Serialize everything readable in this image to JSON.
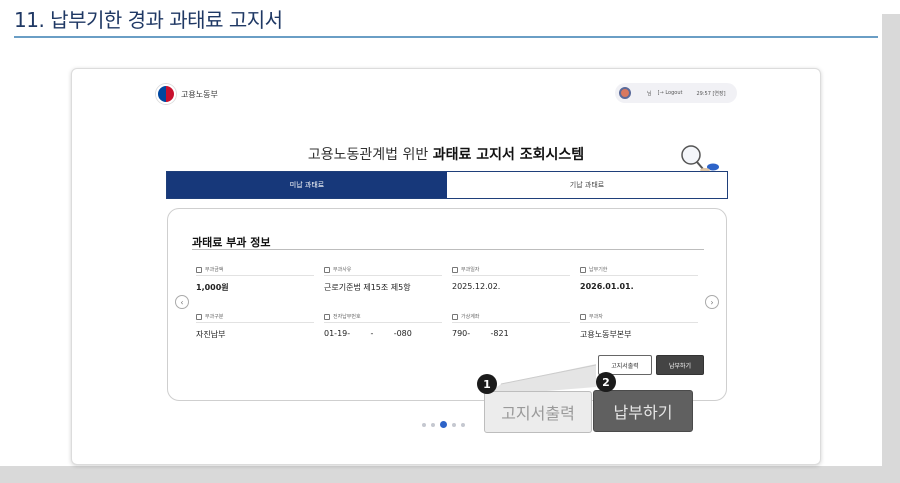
{
  "slide": {
    "title": "11. 납부기한 경과 과태료 고지서"
  },
  "header": {
    "logo_text": "고용노동부",
    "user_name": "님",
    "logout_label": "[→ Logout",
    "session_time": "29:57 [연장]"
  },
  "headline": {
    "prefix": "고용노동관계법 위반",
    "emphasis": "과태료 고지서 조회시스템"
  },
  "tabs": [
    {
      "label": "미납 과태료",
      "active": true
    },
    {
      "label": "기납 과태료",
      "active": false
    }
  ],
  "card": {
    "title": "과태료 부과 정보",
    "fields": [
      {
        "label": "부과금액",
        "value": "1,000원",
        "icon": "wallet-icon",
        "bold": true
      },
      {
        "label": "부과사유",
        "value": "근로기준법 제15조 제5항",
        "icon": "document-icon",
        "bold": false
      },
      {
        "label": "부과일자",
        "value": "2025.12.02.",
        "icon": "calendar-icon",
        "bold": false
      },
      {
        "label": "납부기한",
        "value": "2026.01.01.",
        "icon": "calendar-icon",
        "bold": true
      },
      {
        "label": "부과구분",
        "value": "자진납부",
        "icon": "list-icon",
        "bold": false
      },
      {
        "label": "전자납부번호",
        "value": "01-19-        -        -080",
        "icon": "document-icon",
        "bold": false
      },
      {
        "label": "가상계좌",
        "value": "790-        -821",
        "icon": "bank-icon",
        "bold": false
      },
      {
        "label": "부과자",
        "value": "고용노동부본부",
        "icon": "building-icon",
        "bold": false
      }
    ],
    "print_label": "고지서출력",
    "pay_label": "납부하기"
  },
  "pagination": {
    "count": 5,
    "active_index": 2
  },
  "callouts": {
    "print_label": "고지서출력",
    "pay_label": "납부하기",
    "badge_1": "1",
    "badge_2": "2"
  },
  "colors": {
    "accent": "#17387a",
    "title": "#1f3864",
    "dot_active": "#2d63c8"
  }
}
